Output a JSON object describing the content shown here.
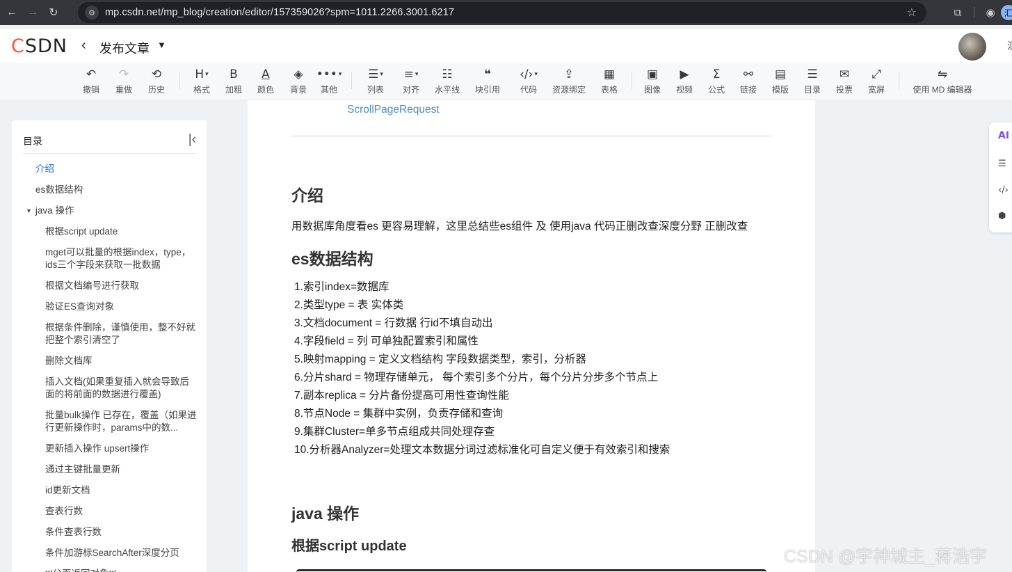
{
  "browser": {
    "url": "mp.csdn.net/mp_blog/creation/editor/157359026?spm=1011.2266.3001.6217",
    "icons": [
      "back-arrow-icon",
      "forward-arrow-icon",
      "reload-icon",
      "site-settings-icon",
      "star-icon",
      "extensions-icon",
      "profile-icon"
    ]
  },
  "header": {
    "logo": "CSDN",
    "title": "发布文章",
    "edge_text": "汇"
  },
  "toolbar": {
    "undo": "撤销",
    "redo": "重做",
    "history": "历史",
    "format": "格式",
    "bold": "加粗",
    "color": "颜色",
    "background": "背景",
    "other": "其他",
    "list": "列表",
    "align": "对齐",
    "hr": "水平线",
    "quote": "块引用",
    "code": "代码",
    "resource": "资源绑定",
    "table": "表格",
    "image": "图像",
    "video": "视频",
    "formula": "公式",
    "link": "链接",
    "template": "模版",
    "toc": "目录",
    "vote": "投票",
    "wide": "宽屏",
    "md": "使用 MD 编辑器"
  },
  "sidebar": {
    "title": "目录",
    "items": [
      {
        "label": "介绍",
        "level": 1,
        "active": true
      },
      {
        "label": "es数据结构",
        "level": 1
      },
      {
        "label": "java 操作",
        "level": 1,
        "expanded": true
      },
      {
        "label": "根据script update",
        "level": 2
      },
      {
        "label": "mget可以批量的根据index，type，ids三个字段来获取一批数据",
        "level": 2
      },
      {
        "label": "根据文档编号进行获取",
        "level": 2
      },
      {
        "label": "验证ES查询对象",
        "level": 2
      },
      {
        "label": "根据条件删除，谨慎使用，整不好就把整个索引清空了",
        "level": 2
      },
      {
        "label": "删除文档库",
        "level": 2
      },
      {
        "label": "插入文档(如果重复插入就会导致后面的将前面的数据进行覆盖)",
        "level": 2
      },
      {
        "label": "批量bulk操作 已存在，覆盖（如果进行更新操作时，params中的数...",
        "level": 2
      },
      {
        "label": "更新插入操作 upsert操作",
        "level": 2
      },
      {
        "label": "通过主键批量更新",
        "level": 2
      },
      {
        "label": "id更新文档",
        "level": 2
      },
      {
        "label": "查表行数",
        "level": 2
      },
      {
        "label": "条件查表行数",
        "level": 2
      },
      {
        "label": "条件加游标SearchAfter深度分页",
        "level": 2
      },
      {
        "label": "ttl分页返回对象ttl",
        "level": 2
      }
    ]
  },
  "document": {
    "toc_link": "ScrollPageRequest",
    "h_intro": "介绍",
    "intro_text": "用数据库角度看es 更容易理解，这里总结些es组件 及 使用java 代码正删改查深度分野 正删改查",
    "h_structure": "es数据结构",
    "structure_list": [
      "1.索引index=数据库",
      "2.类型type = 表 实体类",
      "3.文档document = 行数据 行id不填自动出",
      "4.字段field = 列 可单独配置索引和属性",
      "5.映射mapping = 定义文档结构 字段数据类型，索引，分析器",
      "6.分片shard = 物理存储单元， 每个索引多个分片，每个分片分步多个节点上",
      "7.副本replica = 分片备份提高可用性查询性能",
      "8.节点Node = 集群中实例，负责存储和查询",
      "9.集群Cluster=单多节点组成共同处理存查",
      "10.分析器Analyzer=处理文本数据分词过滤标准化可自定义便于有效索引和搜索"
    ],
    "h_java": "java 操作",
    "h_script": "根据script update"
  },
  "float_panel": {
    "ai_label": "AI",
    "icons": [
      "ai-assistant-icon",
      "outline-icon",
      "code-icon",
      "settings-icon"
    ]
  },
  "watermark": "CSDN @宇神城主_蒋浩宇"
}
